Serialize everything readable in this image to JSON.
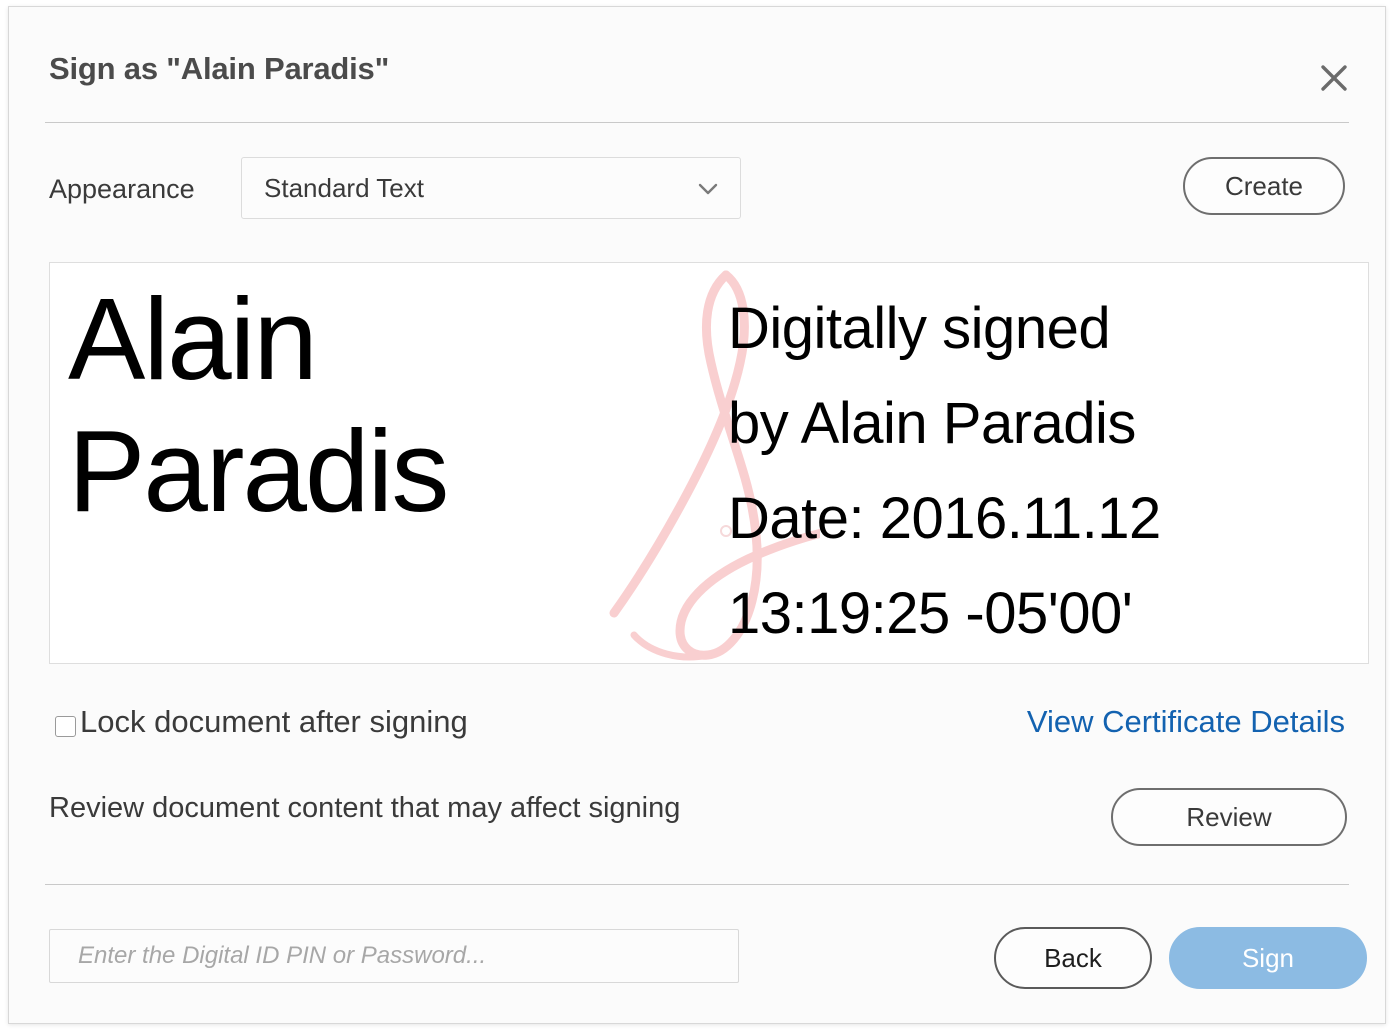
{
  "dialog": {
    "title": "Sign as \"Alain Paradis\"",
    "close_icon": "close-icon"
  },
  "appearance": {
    "label": "Appearance",
    "selected": "Standard Text",
    "chevron_icon": "chevron-down-icon",
    "create_label": "Create"
  },
  "preview": {
    "signature_name_line1": "Alain",
    "signature_name_line2": "Paradis",
    "detail_line1": "Digitally signed",
    "detail_line2": "by Alain Paradis",
    "detail_line3": "Date: 2016.11.12",
    "detail_line4": "13:19:25 -05'00'",
    "watermark_icon": "adobe-acrobat-a-logo-icon",
    "watermark_color": "#f9cfd0"
  },
  "options": {
    "lock_label": "Lock document after signing",
    "lock_checked": false,
    "certificate_link": "View Certificate Details",
    "certificate_link_color": "#1362b0"
  },
  "review": {
    "text": "Review document content that may affect signing",
    "button_label": "Review"
  },
  "footer": {
    "pin_placeholder": "Enter the Digital ID PIN or Password...",
    "pin_value": "",
    "back_label": "Back",
    "sign_label": "Sign",
    "sign_button_color": "#8cbbe3"
  }
}
